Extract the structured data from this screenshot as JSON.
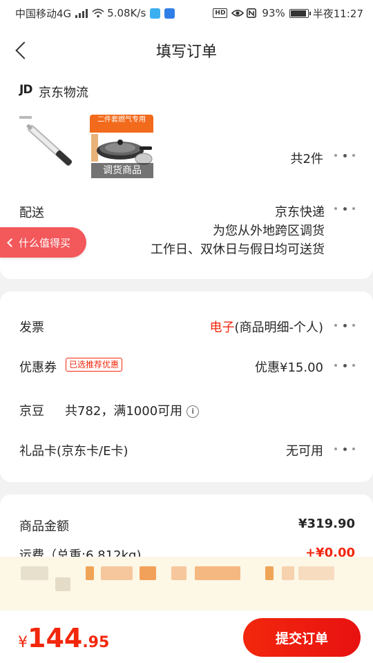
{
  "status_bar": {
    "carrier": "中国移动4G",
    "net_speed": "5.08K/s",
    "battery": "93%",
    "battery_level": 0.93,
    "time": "半夜11:27"
  },
  "header": {
    "title": "填写订单"
  },
  "shipment": {
    "logo": "JD",
    "logistics": "京东物流",
    "product2_banner": "二件套燃气专用",
    "product2_tag": "调货商品",
    "count": "共2件"
  },
  "delivery": {
    "label": "配送",
    "method": "京东快递",
    "note1": "为您从外地跨区调货",
    "note2": "工作日、双休日与假日均可送货"
  },
  "float_pill": {
    "label": "什么值得买"
  },
  "invoice": {
    "label": "发票",
    "value_red": "电子",
    "value_rest": "(商品明细-个人)"
  },
  "coupon": {
    "label": "优惠券",
    "tag": "已选推荐优惠",
    "value": "优惠¥15.00"
  },
  "beans": {
    "label": "京豆",
    "info": "共782，满1000可用"
  },
  "giftcard": {
    "label": "礼品卡(京东卡/E卡)",
    "value": "无可用"
  },
  "amounts": {
    "goods_label": "商品金额",
    "goods_value": "¥319.90",
    "freight_label": "运费（总重:6.812kg)",
    "freight_value": "+¥0.00"
  },
  "bottom": {
    "currency": "¥",
    "total_int": "144",
    "total_dec": ".95",
    "submit": "提交订单"
  },
  "colors": {
    "accent": "#f2270c",
    "pill": "#f3585b",
    "banner_bg": "#fdf7e6"
  }
}
